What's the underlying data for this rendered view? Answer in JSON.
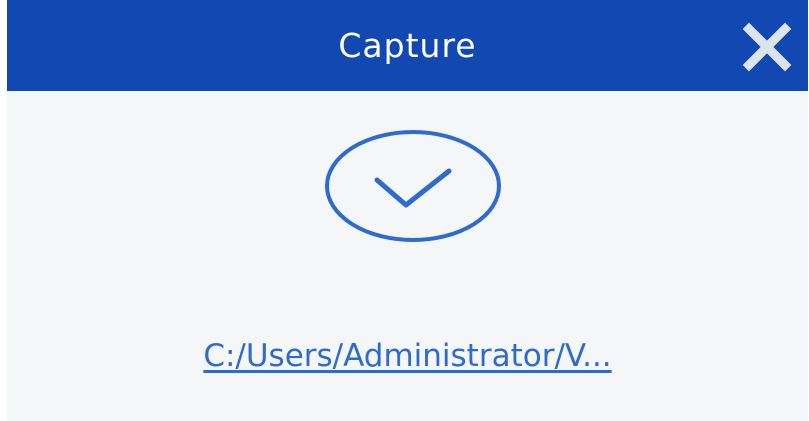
{
  "dialog": {
    "title": "Capture",
    "close_icon": "close-icon",
    "status_icon": "check-circle-icon",
    "saved_path": "C:/Users/Administrator/V..."
  },
  "colors": {
    "titlebar": "#1148b2",
    "title_text": "#ffffff",
    "body_bg": "#f5f6f8",
    "accent": "#2d6bd3"
  }
}
